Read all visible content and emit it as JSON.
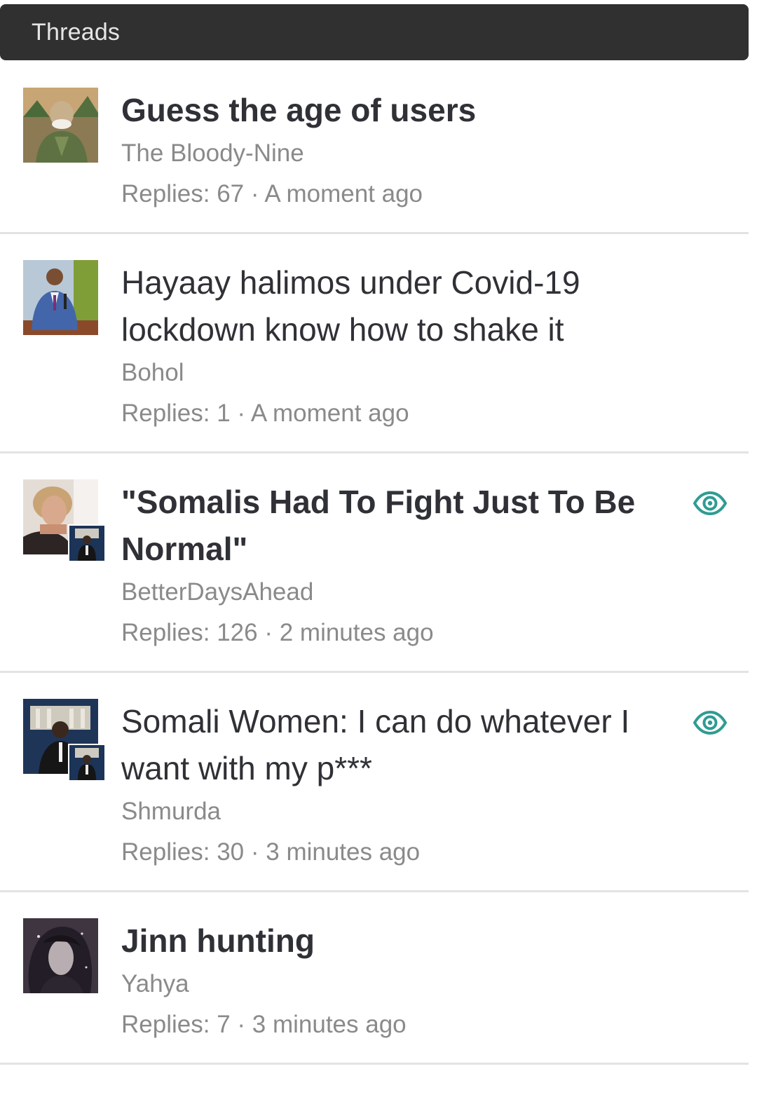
{
  "header": {
    "title": "Threads"
  },
  "threads": [
    {
      "title": "Guess the age of users",
      "unread": true,
      "author": "The Bloody-Nine",
      "replies_label": "Replies:",
      "replies": "67",
      "separator": "·",
      "time": "A moment ago",
      "watched": false,
      "avatar_icon": "user-avatar-image",
      "avatar_colors": [
        "#7a6a45",
        "#b99a62",
        "#5d6f3a"
      ]
    },
    {
      "title": "Hayaay halimos under Covid-19 lockdown know how to shake it",
      "unread": false,
      "author": "Bohol",
      "replies_label": "Replies:",
      "replies": "1",
      "separator": "·",
      "time": "A moment ago",
      "watched": false,
      "avatar_icon": "user-avatar-image",
      "avatar_colors": [
        "#6f8f3c",
        "#3f5f9a",
        "#a97b5a"
      ]
    },
    {
      "title": "\"Somalis Had To Fight Just To Be Normal\"",
      "unread": true,
      "author": "BetterDaysAhead",
      "replies_label": "Replies:",
      "replies": "126",
      "separator": "·",
      "time": "2 minutes ago",
      "watched": true,
      "avatar_icon": "user-avatar-image",
      "avatar_colors": [
        "#d9c7b5",
        "#c9a27d",
        "#eadfd3"
      ],
      "last_poster_icon": "last-poster-avatar-image"
    },
    {
      "title": "Somali Women: I can do whatever I want with my p***",
      "unread": false,
      "author": "Shmurda",
      "replies_label": "Replies:",
      "replies": "30",
      "separator": "·",
      "time": "3 minutes ago",
      "watched": true,
      "avatar_icon": "user-avatar-image",
      "avatar_colors": [
        "#1f3558",
        "#d8d4c8",
        "#222222"
      ],
      "last_poster_icon": "last-poster-avatar-image"
    },
    {
      "title": "Jinn hunting",
      "unread": true,
      "author": "Yahya",
      "replies_label": "Replies:",
      "replies": "7",
      "separator": "·",
      "time": "3 minutes ago",
      "watched": false,
      "avatar_icon": "user-avatar-image",
      "avatar_colors": [
        "#4a3f4a",
        "#a89aa0",
        "#26212a"
      ]
    }
  ],
  "colors": {
    "header_bg": "#303030",
    "title_text": "#2f3136",
    "meta_text": "#8a8a8a",
    "watch_icon": "#2f9c93",
    "divider": "#e3e3e3"
  },
  "icons": {
    "watch": "eye-icon"
  }
}
